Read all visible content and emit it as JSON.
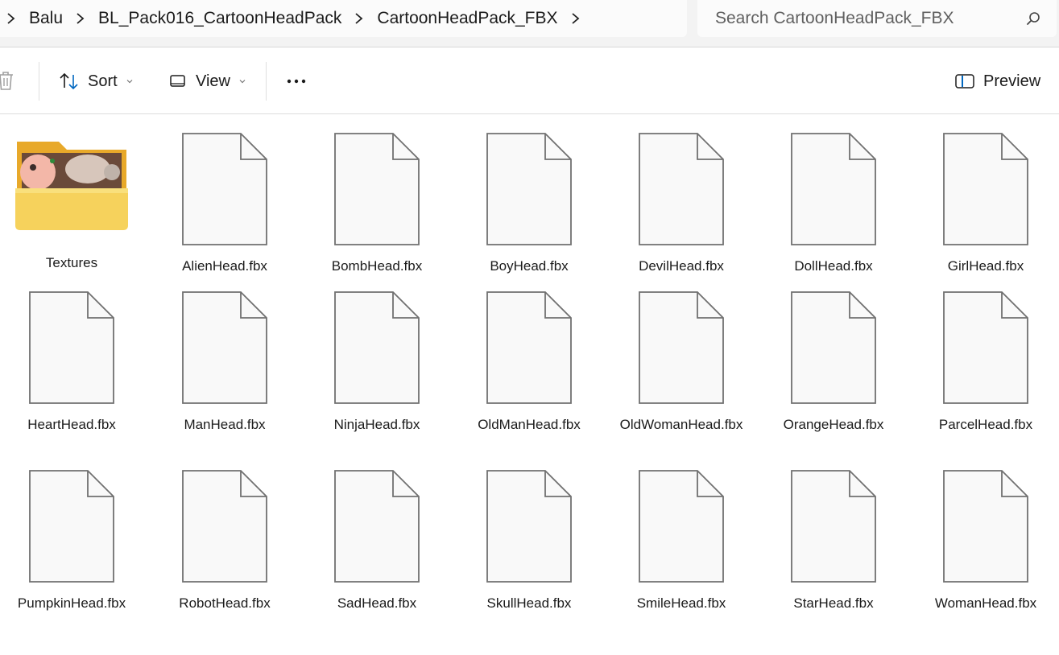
{
  "breadcrumb": {
    "items": [
      "Balu",
      "BL_Pack016_CartoonHeadPack",
      "CartoonHeadPack_FBX"
    ]
  },
  "search": {
    "placeholder": "Search CartoonHeadPack_FBX"
  },
  "toolbar": {
    "sort_label": "Sort",
    "view_label": "View",
    "more_label": "···",
    "preview_label": "Preview"
  },
  "items": [
    {
      "name": "Textures",
      "type": "folder"
    },
    {
      "name": "AlienHead.fbx",
      "type": "file"
    },
    {
      "name": "BombHead.fbx",
      "type": "file"
    },
    {
      "name": "BoyHead.fbx",
      "type": "file"
    },
    {
      "name": "DevilHead.fbx",
      "type": "file"
    },
    {
      "name": "DollHead.fbx",
      "type": "file"
    },
    {
      "name": "GirlHead.fbx",
      "type": "file"
    },
    {
      "name": "HeartHead.fbx",
      "type": "file"
    },
    {
      "name": "ManHead.fbx",
      "type": "file"
    },
    {
      "name": "NinjaHead.fbx",
      "type": "file"
    },
    {
      "name": "OldManHead.fbx",
      "type": "file"
    },
    {
      "name": "OldWomanHead.fbx",
      "type": "file"
    },
    {
      "name": "OrangeHead.fbx",
      "type": "file"
    },
    {
      "name": "ParcelHead.fbx",
      "type": "file"
    },
    {
      "name": "PumpkinHead.fbx",
      "type": "file"
    },
    {
      "name": "RobotHead.fbx",
      "type": "file"
    },
    {
      "name": "SadHead.fbx",
      "type": "file"
    },
    {
      "name": "SkullHead.fbx",
      "type": "file"
    },
    {
      "name": "SmileHead.fbx",
      "type": "file"
    },
    {
      "name": "StarHead.fbx",
      "type": "file"
    },
    {
      "name": "WomanHead.fbx",
      "type": "file"
    }
  ],
  "colors": {
    "folder": "#f4c542",
    "accent": "#0067c0"
  }
}
